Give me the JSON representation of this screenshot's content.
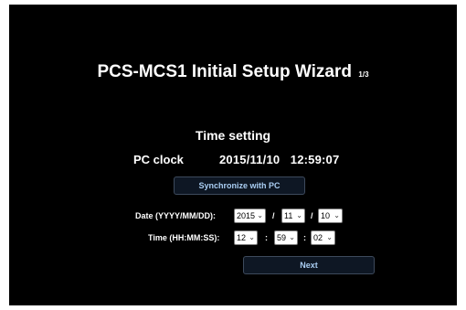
{
  "wizard": {
    "title": "PCS-MCS1 Initial Setup Wizard",
    "step": "1/3"
  },
  "time_setting": {
    "heading": "Time setting",
    "pc_clock_label": "PC clock",
    "pc_clock_value": "2015/11/10   12:59:07",
    "sync_button": "Synchronize with PC",
    "date_label": "Date (YYYY/MM/DD):",
    "time_label": "Time (HH:MM:SS):",
    "date": {
      "year": "2015",
      "month": "11",
      "day": "10",
      "separator": "/"
    },
    "time": {
      "hour": "12",
      "minute": "59",
      "second": "02",
      "separator": ":"
    },
    "next_button": "Next"
  },
  "icons": {
    "dropdown": "chevron-down-icon"
  }
}
